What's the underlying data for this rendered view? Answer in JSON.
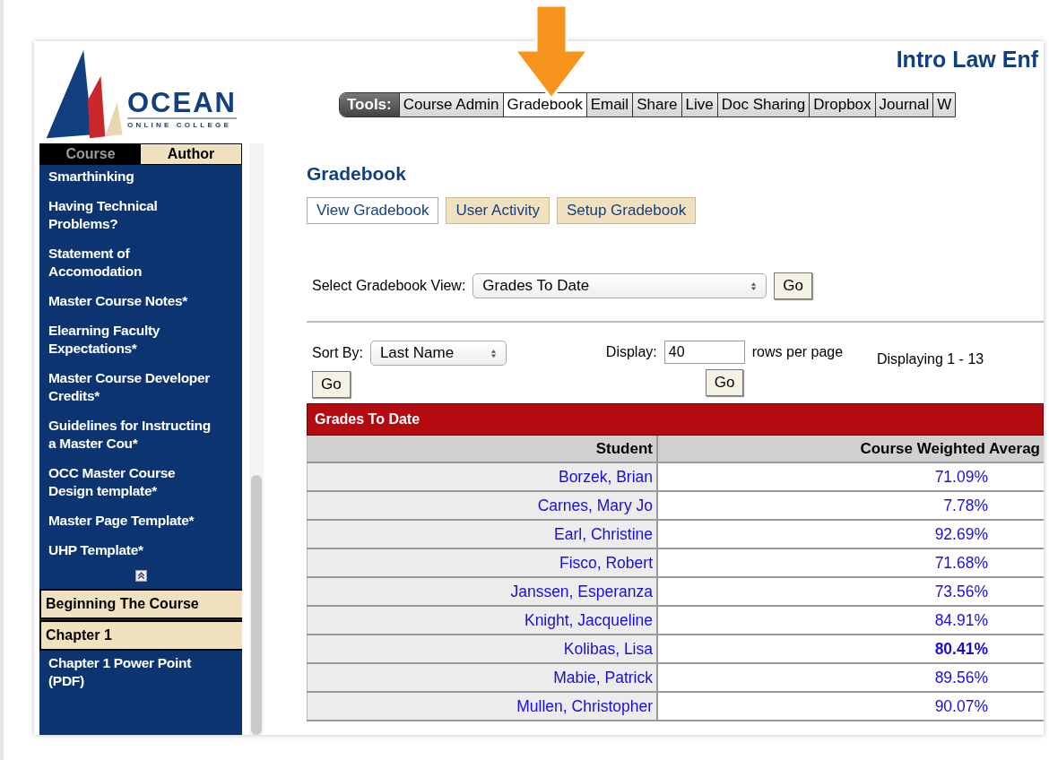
{
  "logo": {
    "name": "OCEAN",
    "tagline": "ONLINE COLLEGE"
  },
  "course_title": "Intro Law Enf",
  "tools": {
    "label": "Tools:",
    "tabs": [
      {
        "label": "Course Admin",
        "selected": false
      },
      {
        "label": "Gradebook",
        "selected": true
      },
      {
        "label": "Email",
        "selected": false
      },
      {
        "label": "Share",
        "selected": false
      },
      {
        "label": "Live",
        "selected": false
      },
      {
        "label": "Doc Sharing",
        "selected": false
      },
      {
        "label": "Dropbox",
        "selected": false
      },
      {
        "label": "Journal",
        "selected": false
      },
      {
        "label": "W",
        "selected": false
      }
    ]
  },
  "sidebar": {
    "tabs": [
      {
        "label": "Course",
        "selected": true
      },
      {
        "label": "Author",
        "selected": false
      }
    ],
    "items": [
      {
        "kind": "link",
        "label": "Smarthinking"
      },
      {
        "kind": "link",
        "label": "Having Technical Problems?"
      },
      {
        "kind": "link",
        "label": "Statement of Accomodation"
      },
      {
        "kind": "link",
        "label": "Master Course Notes*"
      },
      {
        "kind": "link",
        "label": "Elearning Faculty Expectations*"
      },
      {
        "kind": "link",
        "label": "Master Course Developer Credits*"
      },
      {
        "kind": "link",
        "label": "Guidelines for Instructing a Master Cou*"
      },
      {
        "kind": "link",
        "label": "OCC Master Course Design template*"
      },
      {
        "kind": "link",
        "label": "Master Page Template*"
      },
      {
        "kind": "link",
        "label": "UHP Template*"
      },
      {
        "kind": "collapse"
      },
      {
        "kind": "section",
        "label": "Beginning The Course"
      },
      {
        "kind": "section",
        "label": "Chapter 1"
      },
      {
        "kind": "link",
        "label": "Chapter 1 Power Point (PDF)"
      }
    ]
  },
  "page_title": "Gradebook",
  "subtabs": [
    {
      "label": "View Gradebook",
      "selected": true
    },
    {
      "label": "User Activity",
      "selected": false
    },
    {
      "label": "Setup Gradebook",
      "selected": false
    }
  ],
  "view_select": {
    "label": "Select Gradebook View:",
    "value": "Grades To Date",
    "button": "Go"
  },
  "sort": {
    "label": "Sort By:",
    "value": "Last Name",
    "button": "Go"
  },
  "display": {
    "label": "Display:",
    "value": "40",
    "suffix": "rows per page",
    "button": "Go"
  },
  "range_text": "Displaying 1 - 13",
  "table": {
    "title": "Grades To Date",
    "columns": [
      "Student",
      "Course Weighted Averag"
    ],
    "rows": [
      {
        "student": "Borzek, Brian",
        "average": "71.09%",
        "bold": false
      },
      {
        "student": "Carnes, Mary Jo",
        "average": "7.78%",
        "bold": false
      },
      {
        "student": "Earl, Christine",
        "average": "92.69%",
        "bold": false
      },
      {
        "student": "Fisco, Robert",
        "average": "71.68%",
        "bold": false
      },
      {
        "student": "Janssen, Esperanza",
        "average": "73.56%",
        "bold": false
      },
      {
        "student": "Knight, Jacqueline",
        "average": "84.91%",
        "bold": false
      },
      {
        "student": "Kolibas, Lisa",
        "average": "80.41%",
        "bold": true
      },
      {
        "student": "Mabie, Patrick",
        "average": "89.56%",
        "bold": false
      },
      {
        "student": "Mullen, Christopher",
        "average": "90.07%",
        "bold": false
      }
    ]
  }
}
